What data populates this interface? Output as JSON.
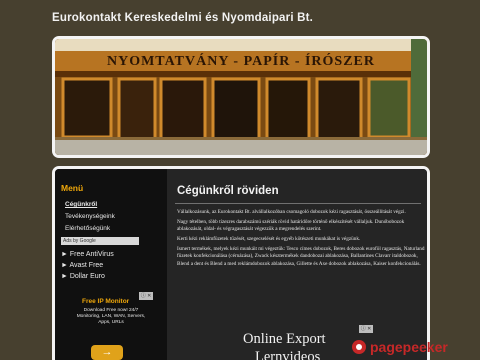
{
  "site": {
    "title": "Eurokontakt Kereskedelmi és Nyomdaipari Bt."
  },
  "banner": {
    "sign_text": "NYOMTATVÁNY - PAPÍR - ÍRÓSZER"
  },
  "sidebar": {
    "menu_title": "Menü",
    "items": [
      {
        "label": "Cégünkről"
      },
      {
        "label": "Tevékenységeink"
      },
      {
        "label": "Elérhetőségünk"
      }
    ],
    "ads_label": "Ads by Google",
    "ad_links": [
      {
        "label": "► Free AntiVirus"
      },
      {
        "label": "► Avast Free"
      },
      {
        "label": "► Dollar Euro"
      }
    ],
    "promo": {
      "title": "Free IP Monitor",
      "text": "Download Free now! 24/7 Monitoring, LAN, WAN, Servers, Apps, URLs",
      "close": "ⓘ ✕"
    },
    "arrow_glyph": "→"
  },
  "content": {
    "title": "Cégünkről röviden",
    "paragraphs": [
      "Vállalkozásunk, az Eurokontakt Bt. alvállalkozóban csomagoló dobozok kézi ragasztását, összeállítását végzi.",
      "Nagy tételben, több tízezres darabszámú szériák rövid határidőre történő elkészítését vállaljuk. Dunóbobozok ablakozását, oldal- és végragasztását végezzük a megrendelés szerint.",
      "Kerti kézi reklámfüzetek tűzését, szegecselését és egyéb kötészeti munkákat is végzünk.",
      "Ismert termékek, melyek kézi munkáit mi végeztük: Tesco címes dobozok, Beres dobozok euroföl ragasztás, Naturland füzetek konfekcionálása (cérnázása), Zwack késztermékek dandobozai ablakozása, Ballantines Clavarr italdobozok, Blend a dent és Blend a med reklámdobozok ablakozása, Gillette és Axe dobozok ablakozása, Kaiser konfekcionálás."
    ],
    "ad": {
      "line1": "Online Export",
      "line2": "Lernvideos",
      "close": "ⓘ ✕"
    }
  },
  "watermark": {
    "text": "pagepeeker"
  }
}
